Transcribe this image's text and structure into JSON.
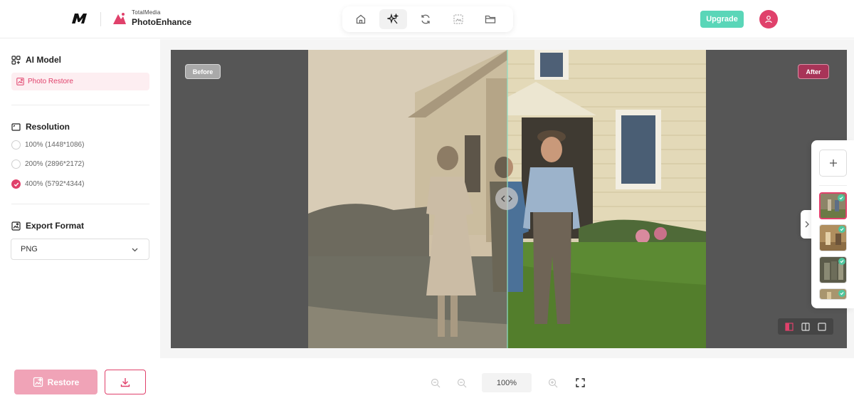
{
  "brand": {
    "company_logo": "M",
    "small": "TotalMedia",
    "name": "PhotoEnhance"
  },
  "toolbar": {
    "items": [
      {
        "icon": "home-icon"
      },
      {
        "icon": "sparkle-icon",
        "active": true
      },
      {
        "icon": "refresh-icon"
      },
      {
        "icon": "image-icon"
      },
      {
        "icon": "folder-icon"
      }
    ]
  },
  "header": {
    "upgrade_label": "Upgrade",
    "avatar_icon": "user-icon"
  },
  "sidebar": {
    "ai_model": {
      "title": "AI Model",
      "selected": "Photo Restore"
    },
    "resolution": {
      "title": "Resolution",
      "options": [
        {
          "label": "100% (1448*1086)",
          "checked": false
        },
        {
          "label": "200% (2896*2172)",
          "checked": false
        },
        {
          "label": "400% (5792*4344)",
          "checked": true
        }
      ]
    },
    "export_format": {
      "title": "Export Format",
      "value": "PNG"
    },
    "restore_label": "Restore"
  },
  "viewer": {
    "before_label": "Before",
    "after_label": "After",
    "split_position": 0.5
  },
  "zoom": {
    "value": "100%"
  },
  "colors": {
    "accent": "#e0416b",
    "upgrade": "#5ad6b8",
    "restore_disabled": "#f0a3b7",
    "after_tag": "#a83458"
  }
}
